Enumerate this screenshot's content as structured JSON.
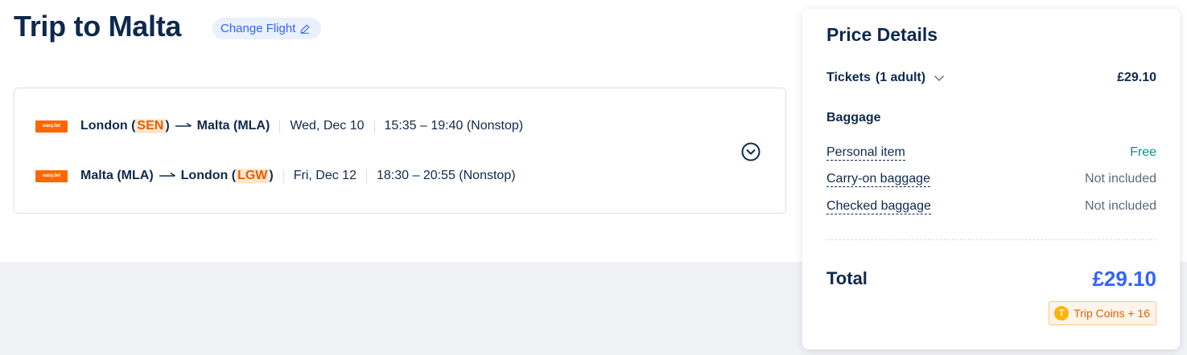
{
  "trip": {
    "title": "Trip to Malta",
    "change_flight_label": "Change Flight"
  },
  "legs": [
    {
      "airline_logo_text": "easyJet",
      "from_city": "London (",
      "from_code": "SEN",
      "from_close": ")",
      "to": "Malta (MLA)",
      "date": "Wed, Dec 10",
      "time": "15:35 – 19:40 (Nonstop)"
    },
    {
      "airline_logo_text": "easyJet",
      "from": "Malta (MLA)",
      "to_city": "London (",
      "to_code": "LGW",
      "to_close": ")",
      "date": "Fri, Dec 12",
      "time": "18:30 – 20:55 (Nonstop)"
    }
  ],
  "price": {
    "title": "Price Details",
    "tickets_label": "Tickets",
    "tickets_count": "(1 adult)",
    "tickets_amount": "£29.10",
    "baggage_heading": "Baggage",
    "baggage": [
      {
        "label": "Personal item",
        "value": "Free"
      },
      {
        "label": "Carry-on baggage",
        "value": "Not included"
      },
      {
        "label": "Checked baggage",
        "value": "Not included"
      }
    ],
    "total_label": "Total",
    "total_amount": "£29.10",
    "coins_label": "Trip Coins + 16",
    "coin_glyph": "T"
  },
  "colors": {
    "accent": "#3264ff",
    "highlight": "#e35f00",
    "airline": "#ff6600"
  }
}
